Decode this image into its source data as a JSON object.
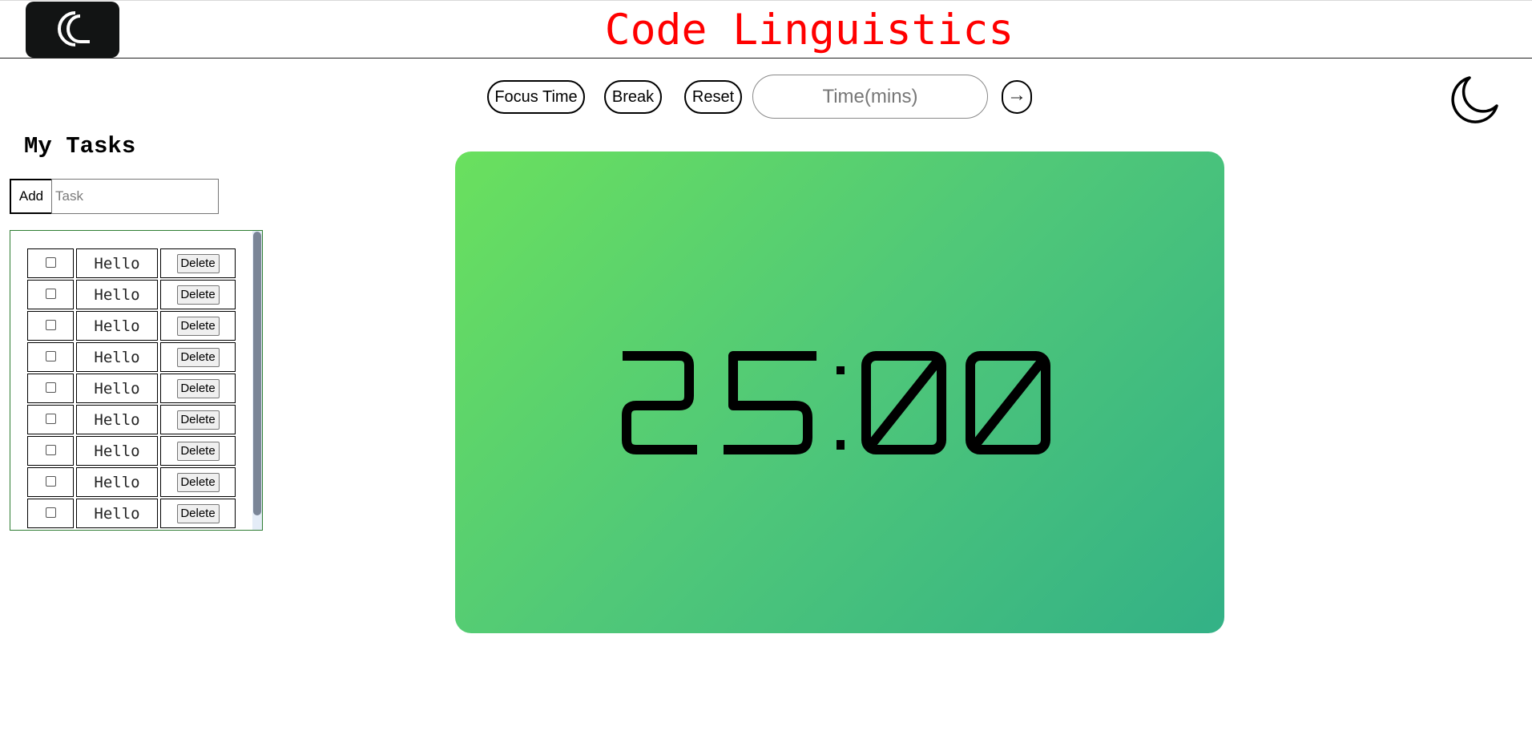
{
  "header": {
    "logo_text": "CL",
    "title": "Code Linguistics"
  },
  "controls": {
    "focus_label": "Focus Time",
    "break_label": "Break",
    "reset_label": "Reset",
    "time_placeholder": "Time(mins)",
    "go_label": "→",
    "theme_icon": "moon-icon"
  },
  "tasks": {
    "heading": "My Tasks",
    "add_label": "Add",
    "input_placeholder": "Task",
    "items": [
      {
        "text": "Hello",
        "done": false,
        "delete_label": "Delete"
      },
      {
        "text": "Hello",
        "done": false,
        "delete_label": "Delete"
      },
      {
        "text": "Hello",
        "done": false,
        "delete_label": "Delete"
      },
      {
        "text": "Hello",
        "done": false,
        "delete_label": "Delete"
      },
      {
        "text": "Hello",
        "done": false,
        "delete_label": "Delete"
      },
      {
        "text": "Hello",
        "done": false,
        "delete_label": "Delete"
      },
      {
        "text": "Hello",
        "done": false,
        "delete_label": "Delete"
      },
      {
        "text": "Hello",
        "done": false,
        "delete_label": "Delete"
      },
      {
        "text": "Hello",
        "done": false,
        "delete_label": "Delete"
      }
    ]
  },
  "timer": {
    "display": "25:00"
  },
  "colors": {
    "title": "#ff0000",
    "logo_bg": "#121414",
    "card_start": "#6ae05e",
    "card_end": "#33b186"
  }
}
